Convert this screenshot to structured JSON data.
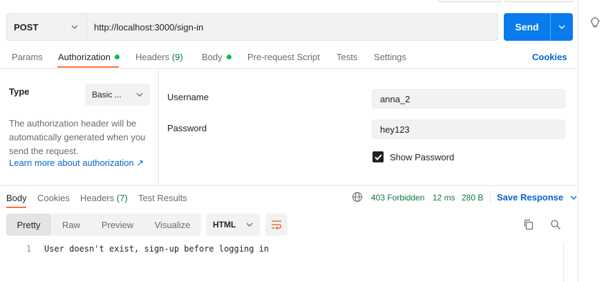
{
  "request": {
    "method": "POST",
    "url": "http://localhost:3000/sign-in",
    "send_label": "Send"
  },
  "request_tabs": {
    "params": "Params",
    "authorization": "Authorization",
    "headers": "Headers",
    "headers_count": "(9)",
    "body": "Body",
    "prerequest": "Pre-request Script",
    "tests": "Tests",
    "settings": "Settings",
    "cookies": "Cookies"
  },
  "auth": {
    "type_label": "Type",
    "type_value": "Basic ...",
    "description": "The authorization header will be automatically generated when you send the request.",
    "learn_more": "Learn more about authorization ↗",
    "username_label": "Username",
    "username_value": "anna_2",
    "password_label": "Password",
    "password_value": "hey123",
    "show_password_label": "Show Password",
    "show_password_checked": true
  },
  "response_tabs": {
    "body": "Body",
    "cookies": "Cookies",
    "headers": "Headers",
    "headers_count": "(7)",
    "test_results": "Test Results"
  },
  "response_meta": {
    "status": "403 Forbidden",
    "time": "12 ms",
    "size": "280 B",
    "save_response": "Save Response"
  },
  "response_view": {
    "options": [
      "Pretty",
      "Raw",
      "Preview",
      "Visualize"
    ],
    "selected": "Pretty",
    "format": "HTML"
  },
  "response_body": {
    "line_number": "1",
    "line_text": "User doesn't exist, sign-up before logging in"
  },
  "colors": {
    "accent_orange": "#ff6c37",
    "send_blue": "#097bed",
    "link_blue": "#0265d2",
    "status_green": "#0c7a3e",
    "dot_green": "#0cbb52"
  }
}
